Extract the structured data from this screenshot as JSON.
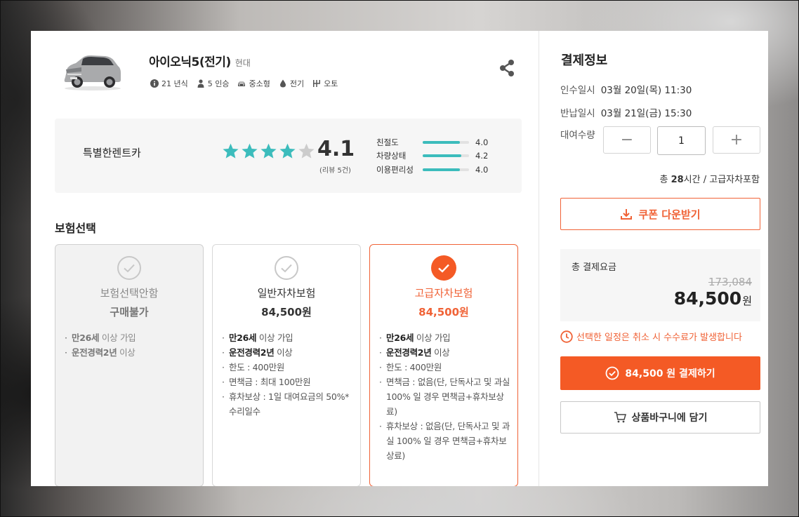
{
  "car": {
    "name": "아이오닉5(전기)",
    "brand": "현대",
    "specs": [
      {
        "icon": "info-icon",
        "text": "21 년식"
      },
      {
        "icon": "person-icon",
        "text": "5 인승"
      },
      {
        "icon": "car-icon",
        "text": "중소형"
      },
      {
        "icon": "fuel-drop-icon",
        "text": "전기"
      },
      {
        "icon": "gearshift-icon",
        "text": "오토"
      }
    ]
  },
  "rating": {
    "company": "특별한렌트카",
    "score": "4.1",
    "stars_filled": 4,
    "stars_total": 5,
    "review_count": "(리뷰 5건)",
    "breakdown": [
      {
        "label": "친절도",
        "value": "4.0",
        "ratio": 0.8
      },
      {
        "label": "차량상태",
        "value": "4.2",
        "ratio": 0.84
      },
      {
        "label": "이용편리성",
        "value": "4.0",
        "ratio": 0.8
      }
    ],
    "colors": {
      "star_filled": "#3cbcbc",
      "star_empty": "#cccccc",
      "bar": "#3cbcbc"
    }
  },
  "insurance": {
    "title": "보험선택",
    "options": [
      {
        "name": "보험선택안함",
        "price": "구매불가",
        "state": "disabled",
        "terms": [
          {
            "bold": "만26세",
            "rest": " 이상 가입"
          },
          {
            "bold": "운전경력2년",
            "rest": " 이상"
          }
        ]
      },
      {
        "name": "일반자차보험",
        "price": "84,500원",
        "state": "normal",
        "terms": [
          {
            "bold": "만26세",
            "rest": " 이상 가입"
          },
          {
            "bold": "운전경력2년",
            "rest": " 이상"
          },
          {
            "bold": "",
            "rest": "한도 : 400만원"
          },
          {
            "bold": "",
            "rest": "면책금 : 최대 100만원"
          },
          {
            "bold": "",
            "rest": "휴차보상 : 1일 대여요금의 50%*수리일수"
          }
        ]
      },
      {
        "name": "고급자차보험",
        "price": "84,500원",
        "state": "selected",
        "terms": [
          {
            "bold": "만26세",
            "rest": " 이상 가입"
          },
          {
            "bold": "운전경력2년",
            "rest": " 이상"
          },
          {
            "bold": "",
            "rest": "한도 : 400만원"
          },
          {
            "bold": "",
            "rest": "면책금 : 없음(단, 단독사고 및 과실 100% 일 경우 면책금+휴차보상료)"
          },
          {
            "bold": "",
            "rest": "휴차보상 : 없음(단, 단독사고 및 과실 100% 일 경우 면책금+휴차보상료)"
          }
        ]
      }
    ]
  },
  "payment": {
    "title": "결제정보",
    "pickup_label": "인수일시",
    "pickup_value": "03월 20일(목) 11:30",
    "return_label": "반납일시",
    "return_value": "03월 21일(금) 15:30",
    "quantity_label": "대여수량",
    "quantity_value": "1",
    "minus_symbol": "−",
    "plus_symbol": "+",
    "total_time_prefix": "총 ",
    "total_time_hours": "28",
    "total_time_suffix": "시간 / 고급자차포함",
    "coupon_label": "쿠폰 다운받기",
    "total_label": "총 결제요금",
    "original_price": "173,084",
    "final_price": "84,500",
    "currency": "원",
    "warning": "선택한 일정은 취소 시 수수료가 발생합니다",
    "pay_button": "84,500 원 결제하기",
    "cart_button": "상품바구니에 담기",
    "accent_color": "#f45a25"
  }
}
